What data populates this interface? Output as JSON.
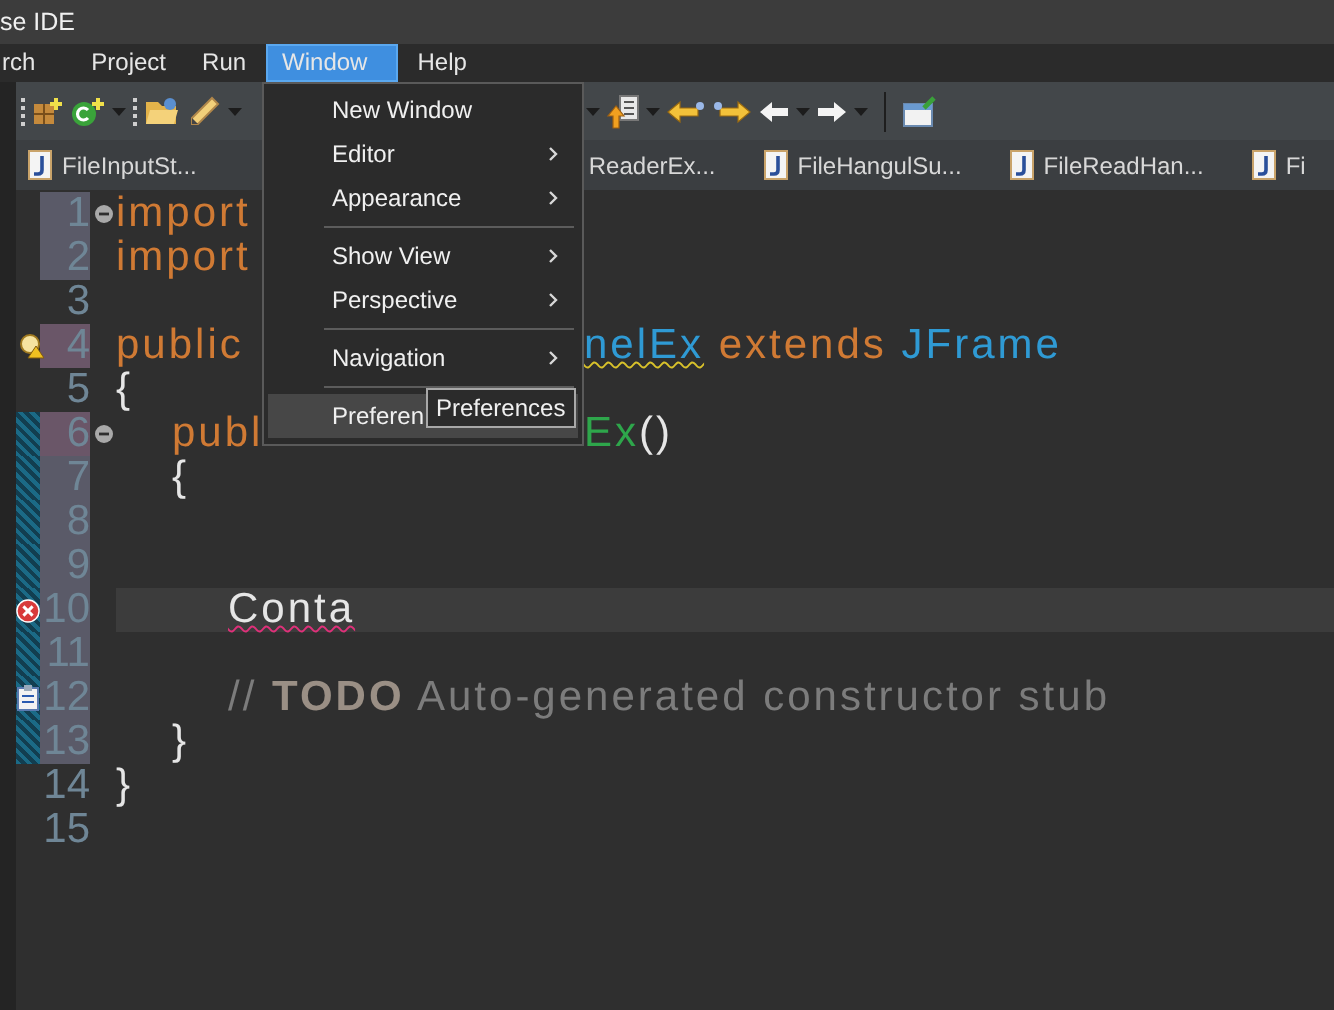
{
  "window": {
    "title": "se IDE"
  },
  "menu_bar": [
    {
      "label": "rch",
      "selected": false
    },
    {
      "label": "Project",
      "selected": false
    },
    {
      "label": "Run",
      "selected": false
    },
    {
      "label": "Window",
      "selected": true
    },
    {
      "label": "Help",
      "selected": false
    }
  ],
  "editor_tabs": [
    {
      "label": "FileInputSt...",
      "kind": "file"
    },
    {
      "label": "ReaderEx...",
      "kind": "cut"
    },
    {
      "label": "FileHangulSu...",
      "kind": "file"
    },
    {
      "label": "FileReadHan...",
      "kind": "file"
    },
    {
      "label": "Fi",
      "kind": "file"
    }
  ],
  "window_menu": {
    "items": [
      {
        "kind": "item",
        "label": "New Window",
        "submenu": false,
        "selected": false
      },
      {
        "kind": "item",
        "label": "Editor",
        "submenu": true,
        "selected": false
      },
      {
        "kind": "item",
        "label": "Appearance",
        "submenu": true,
        "selected": false
      },
      {
        "kind": "separator"
      },
      {
        "kind": "item",
        "label": "Show View",
        "submenu": true,
        "selected": false
      },
      {
        "kind": "item",
        "label": "Perspective",
        "submenu": true,
        "selected": false
      },
      {
        "kind": "separator"
      },
      {
        "kind": "item",
        "label": "Navigation",
        "submenu": true,
        "selected": false
      },
      {
        "kind": "separator"
      },
      {
        "kind": "item",
        "label": "Preferen",
        "submenu": false,
        "selected": true
      }
    ]
  },
  "tooltip": {
    "text": "Preferences"
  },
  "code_lines": [
    {
      "number": "1",
      "added": true,
      "fold_expanded": true,
      "segments": [
        [
          {
            "text": "import",
            "kind": "keyword"
          }
        ]
      ]
    },
    {
      "number": "2",
      "added": true,
      "segments": [
        [
          {
            "text": "import",
            "kind": "keyword"
          }
        ]
      ]
    },
    {
      "number": "3"
    },
    {
      "number": "4",
      "modified": true,
      "annotation": {
        "kind": "warning"
      },
      "segments": [
        [
          {
            "text": "public",
            "kind": "keyword"
          }
        ],
        [
          {
            "text": "nelEx",
            "kind": "type",
            "warning_underline": true
          },
          {
            "text": " extends ",
            "kind": "keyword"
          },
          {
            "text": "JFrame",
            "kind": "type"
          }
        ]
      ]
    },
    {
      "number": "5",
      "segments": [
        [
          {
            "text": "{",
            "kind": "plain"
          }
        ]
      ]
    },
    {
      "number": "6",
      "modified": true,
      "range": true,
      "fold_expanded": true,
      "segments": [
        [
          {
            "text": "\tpubl",
            "kind": "keyword"
          }
        ],
        [
          {
            "text": "Ex",
            "kind": "method"
          },
          {
            "text": "()",
            "kind": "plain"
          }
        ]
      ]
    },
    {
      "number": "7",
      "added": true,
      "range": true,
      "segments": [
        [
          {
            "text": "\t{",
            "kind": "plain"
          }
        ]
      ]
    },
    {
      "number": "8",
      "added": true,
      "range": true
    },
    {
      "number": "9",
      "added": true,
      "range": true
    },
    {
      "number": "10",
      "added": true,
      "range": true,
      "annotation": {
        "kind": "error"
      },
      "current": true,
      "segments": [
        [
          {
            "text": "\t\tConta",
            "kind": "plain",
            "error_underline": true
          }
        ]
      ]
    },
    {
      "number": "11",
      "added": true,
      "range": true
    },
    {
      "number": "12",
      "added": true,
      "range": true,
      "annotation": {
        "kind": "task"
      },
      "segments": [
        [
          {
            "text": "\t\t// ",
            "kind": "comment"
          },
          {
            "text": "TODO",
            "kind": "todo"
          },
          {
            "text": " Auto-generated constructor stub",
            "kind": "comment"
          }
        ]
      ]
    },
    {
      "number": "13",
      "added": true,
      "range": true,
      "segments": [
        [
          {
            "text": "\t}",
            "kind": "plain"
          }
        ]
      ]
    },
    {
      "number": "14",
      "segments": [
        [
          {
            "text": "}",
            "kind": "plain"
          }
        ]
      ]
    },
    {
      "number": "15"
    }
  ]
}
